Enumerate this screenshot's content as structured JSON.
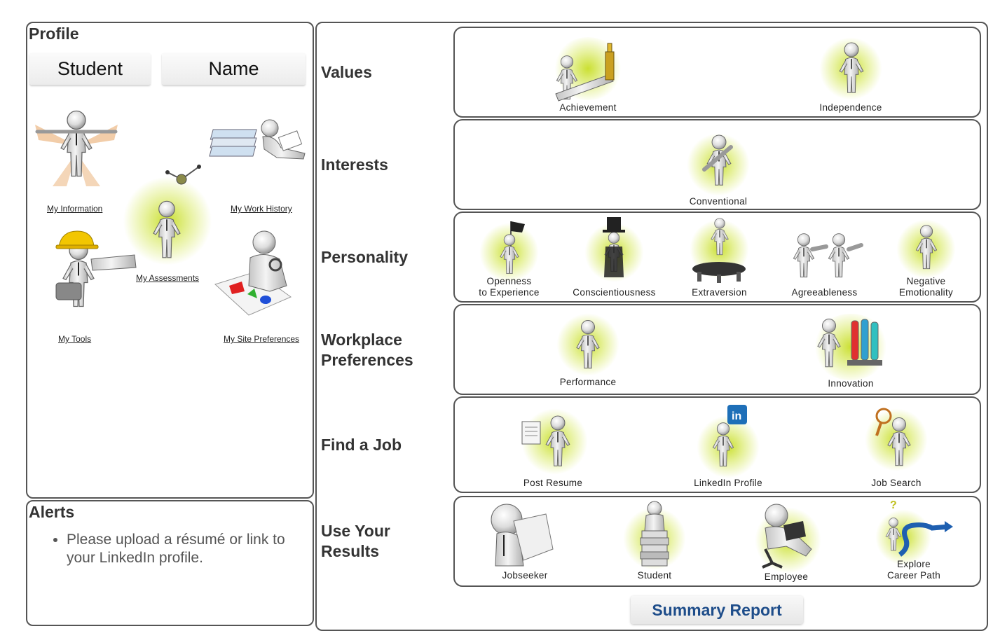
{
  "profile": {
    "title": "Profile",
    "first_name": "Student",
    "last_name": "Name",
    "links": {
      "info": "My Information",
      "work": "My Work History",
      "assessments": "My Assessments",
      "tools": "My Tools",
      "prefs": "My Site Preferences"
    }
  },
  "alerts": {
    "title": "Alerts",
    "items": [
      "Please upload a résumé or link to your LinkedIn profile."
    ]
  },
  "sections": {
    "values": {
      "label": "Values",
      "items": [
        "Achievement",
        "Independence"
      ]
    },
    "interests": {
      "label": "Interests",
      "items": [
        "Conventional"
      ]
    },
    "personality": {
      "label": "Personality",
      "items": [
        "Openness",
        "to Experience",
        "Conscientiousness",
        "Extraversion",
        "Agreeableness",
        "Negative",
        "Emotionality"
      ]
    },
    "workplace": {
      "label_line1": "Workplace",
      "label_line2": "Preferences",
      "items": [
        "Performance",
        "Innovation"
      ]
    },
    "job": {
      "label": "Find a Job",
      "items": [
        "Post Resume",
        "LinkedIn Profile",
        "Job Search"
      ]
    },
    "results": {
      "label_line1": "Use Your",
      "label_line2": "Results",
      "items": [
        "Jobseeker",
        "Student",
        "Employee",
        "Explore",
        "Career Path"
      ]
    }
  },
  "summary_button": "Summary Report",
  "colors": {
    "glow": "#c8de28",
    "link_blue": "#1e4d8a",
    "linkedin": "#1e6fb8"
  }
}
